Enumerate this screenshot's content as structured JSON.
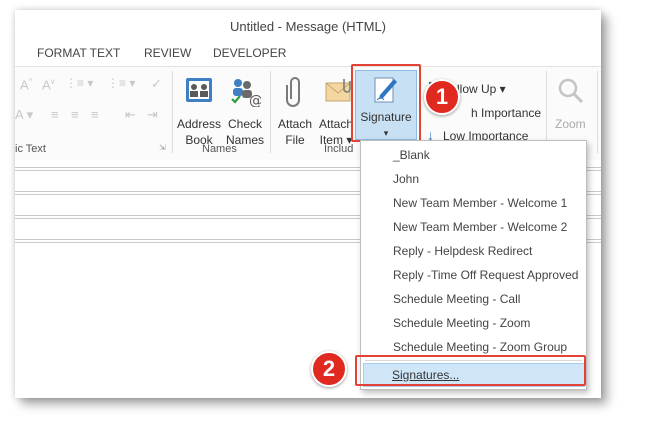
{
  "window": {
    "title": "Untitled - Message (HTML)"
  },
  "tabs": [
    "FORMAT TEXT",
    "REVIEW",
    "DEVELOPER"
  ],
  "ribbon": {
    "basic_text_label": "ic Text",
    "names_label": "Names",
    "include_label": "Includ",
    "address_book": [
      "Address",
      "Book"
    ],
    "check_names": [
      "Check",
      "Names"
    ],
    "attach_file": [
      "Attach",
      "File"
    ],
    "attach_item": [
      "Attach",
      "Item ▾"
    ],
    "signature": "Signature",
    "signature_arrow": "▾",
    "follow_up": "Follow Up ▾",
    "high_importance": "h Importance",
    "low_importance": "Low Importance",
    "zoom": "Zoom"
  },
  "signature_menu": {
    "items": [
      "_Blank",
      "John",
      "New Team Member - Welcome 1",
      "New Team Member - Welcome 2",
      "Reply - Helpdesk Redirect",
      "Reply -Time Off Request Approved",
      "Schedule Meeting - Call",
      "Schedule Meeting - Zoom",
      "Schedule Meeting - Zoom Group"
    ],
    "signatures_link": "Signatures..."
  },
  "callouts": {
    "step1": "1",
    "step2": "2"
  },
  "colors": {
    "callout_red": "#e02a20",
    "highlight_blue": "#cfe6f8",
    "accent_blue": "#2f76c1"
  }
}
